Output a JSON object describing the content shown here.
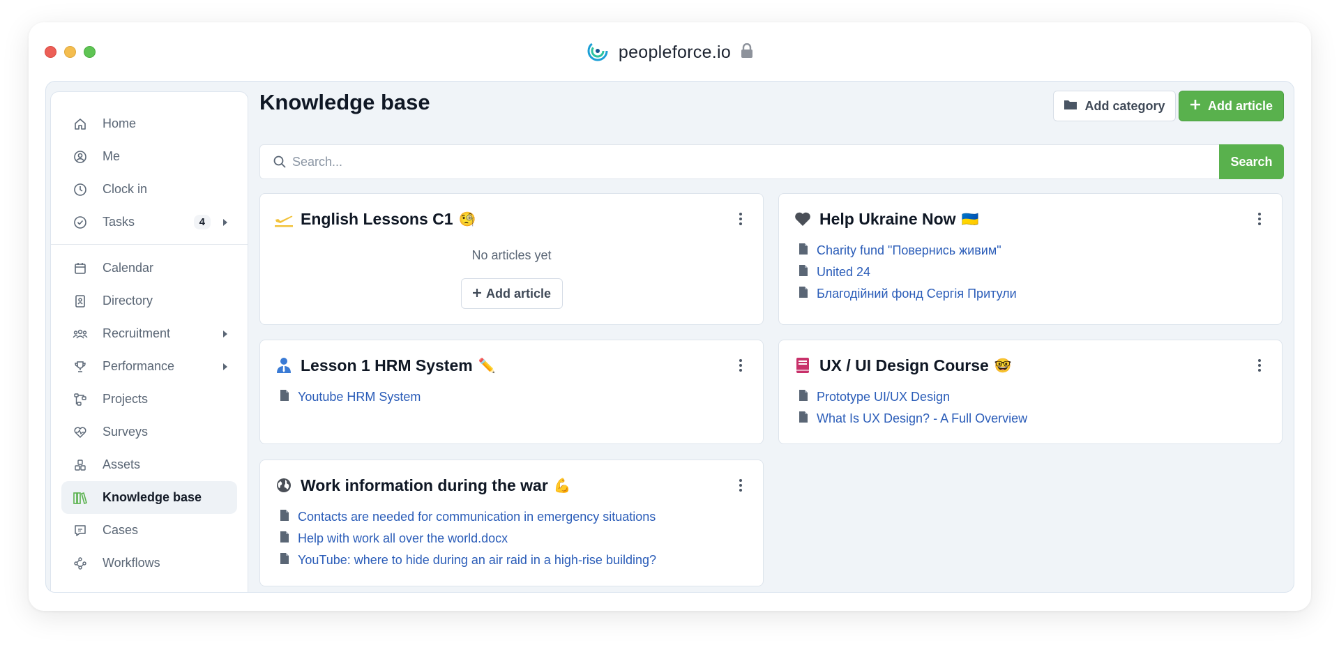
{
  "window": {
    "site_title": "peopleforce.io"
  },
  "sidebar": {
    "group1": [
      {
        "label": "Home",
        "icon": "home-icon"
      },
      {
        "label": "Me",
        "icon": "user-circle-icon"
      },
      {
        "label": "Clock in",
        "icon": "clock-icon"
      },
      {
        "label": "Tasks",
        "icon": "check-circle-icon",
        "badge": "4"
      }
    ],
    "group2": [
      {
        "label": "Calendar",
        "icon": "calendar-icon"
      },
      {
        "label": "Directory",
        "icon": "contact-card-icon"
      },
      {
        "label": "Recruitment",
        "icon": "people-icon"
      },
      {
        "label": "Performance",
        "icon": "trophy-icon"
      },
      {
        "label": "Projects",
        "icon": "projects-icon"
      },
      {
        "label": "Surveys",
        "icon": "heart-pulse-icon"
      },
      {
        "label": "Assets",
        "icon": "boxes-icon"
      },
      {
        "label": "Knowledge base",
        "icon": "books-icon"
      },
      {
        "label": "Cases",
        "icon": "chat-icon"
      },
      {
        "label": "Workflows",
        "icon": "workflow-icon"
      }
    ]
  },
  "main": {
    "title": "Knowledge base",
    "add_category": "Add category",
    "add_article": "Add article",
    "search_placeholder": "Search...",
    "search_button": "Search"
  },
  "cards": [
    {
      "title": "English Lessons C1",
      "emoji": "🧐",
      "empty_text": "No articles yet",
      "add_label": "Add article",
      "articles": []
    },
    {
      "title": "Help Ukraine Now",
      "emoji": "🇺🇦",
      "articles": [
        "Charity fund \"Повернись живим\"",
        "United 24",
        "Благодійний фонд Сергія Притули"
      ]
    },
    {
      "title": "Lesson 1 HRM System",
      "emoji": "✏️",
      "articles": [
        "Youtube HRM System"
      ]
    },
    {
      "title": "UX / UI Design Course",
      "emoji": "🤓",
      "articles": [
        "Prototype UI/UX Design",
        "What Is UX Design? - A Full Overview"
      ]
    },
    {
      "title": "Work information during the war",
      "emoji": "💪",
      "articles": [
        "Contacts are needed for communication in emergency situations",
        "Help with work all over the world.docx",
        "YouTube: where to hide during an air raid in a high-rise building?"
      ]
    }
  ],
  "colors": {
    "accent_green": "#59b14d",
    "link_blue": "#2a5cb8",
    "active_bg": "#eef2f6"
  }
}
